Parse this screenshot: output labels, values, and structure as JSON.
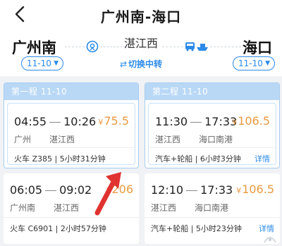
{
  "header": {
    "title": "广州南-海口",
    "origin": "广州南",
    "destination": "海口",
    "transfer_city": "湛江西",
    "origin_date": "11-10",
    "dest_date": "11-10",
    "switch_label": "切换中转"
  },
  "legs": [
    {
      "header_label": "第一程  11-10"
    },
    {
      "header_label": "第二程  11-10"
    }
  ],
  "options": {
    "leg1": [
      {
        "depart_time": "04:55",
        "arrive_time": "10:26",
        "price": "75.5",
        "from_station": "广州",
        "to_station": "湛江西",
        "mode": "火车 Z385",
        "duration": "5小时31分钟",
        "detail": ""
      },
      {
        "depart_time": "06:05",
        "arrive_time": "09:02",
        "price": "206",
        "from_station": "广州南",
        "to_station": "湛江西",
        "mode": "火车 C6901",
        "duration": "2小时57分钟",
        "detail": ""
      }
    ],
    "leg2": [
      {
        "depart_time": "11:30",
        "arrive_time": "17:33",
        "price": "106.5",
        "from_station": "湛江西",
        "to_station": "海口南港",
        "mode": "汽车+轮船",
        "duration": "6小时3分钟",
        "detail": "详情"
      },
      {
        "depart_time": "12:10",
        "arrive_time": "17:33",
        "price": "106.5",
        "from_station": "湛江西",
        "to_station": "海口南港",
        "mode": "汽车+轮船",
        "duration": "5小时23分钟",
        "detail": "详情"
      }
    ]
  },
  "ui": {
    "currency_symbol": "¥",
    "mode_separator": " | ",
    "accent_color": "#2b8be8",
    "price_color": "#e89a43",
    "annotation_arrow_color": "#e0322f"
  }
}
